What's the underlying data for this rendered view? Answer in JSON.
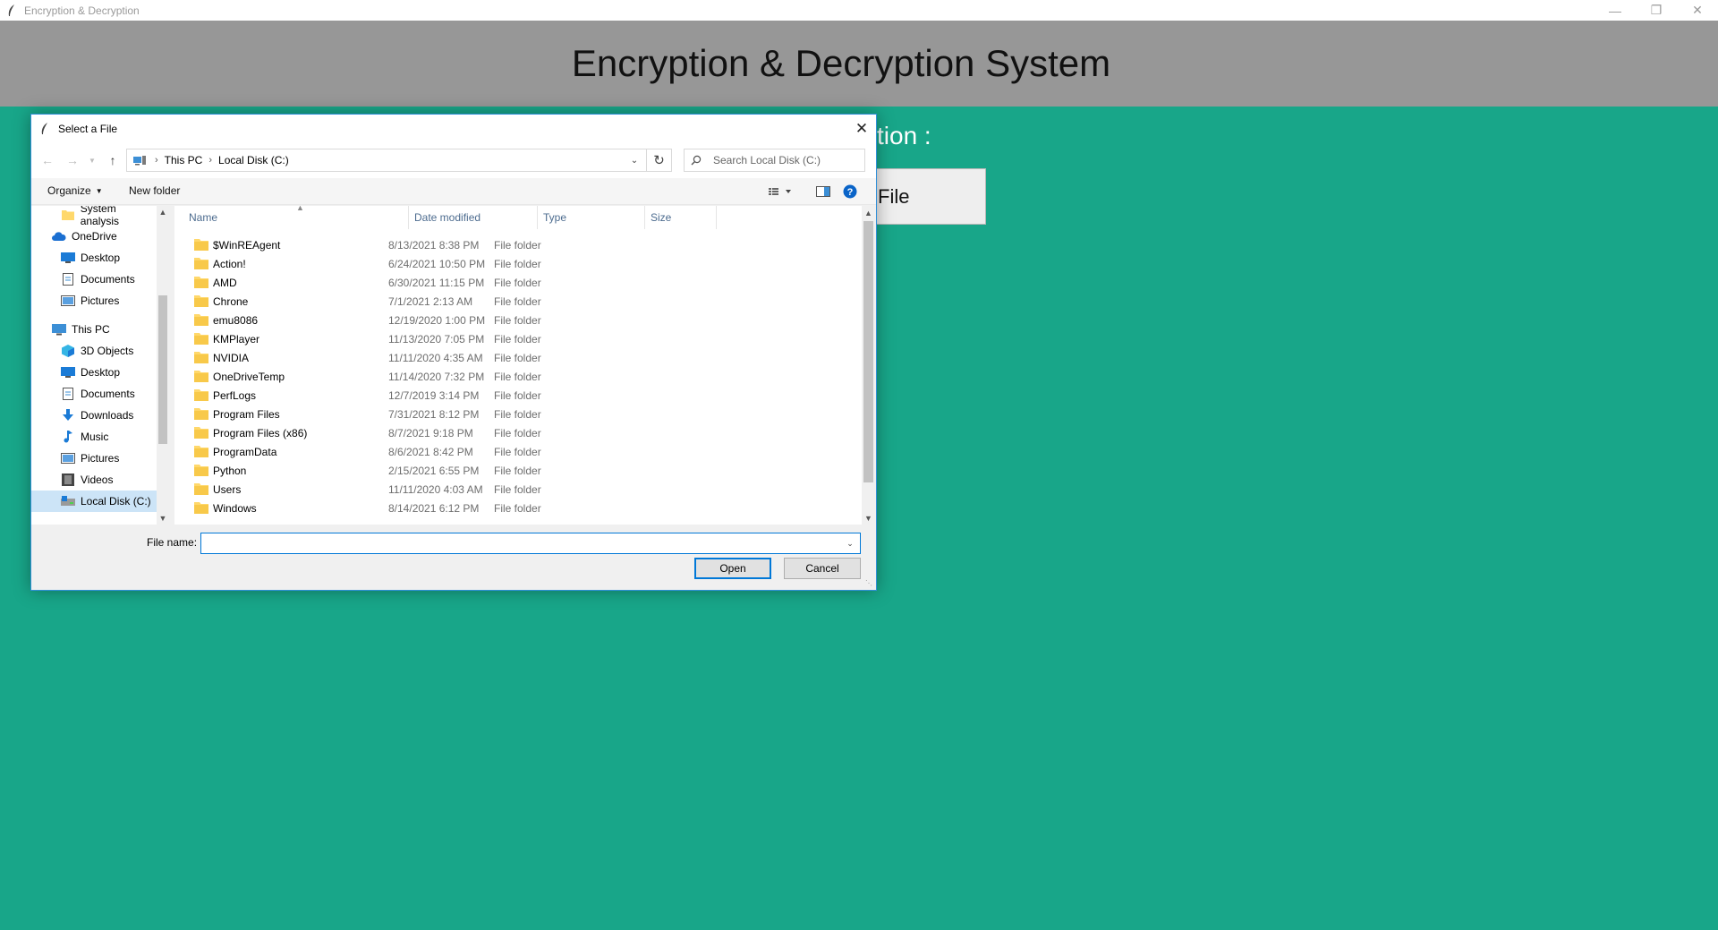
{
  "window": {
    "title": "Encryption & Decryption",
    "controls": [
      "minimize",
      "restore",
      "close"
    ]
  },
  "app": {
    "heading": "Encryption & Decryption System",
    "section_label_partial": "tion :",
    "file_button_partial": "File"
  },
  "dialog": {
    "title": "Select a File",
    "breadcrumb": [
      "This PC",
      "Local Disk (C:)"
    ],
    "search_placeholder": "Search Local Disk (C:)",
    "toolbar": {
      "organize": "Organize",
      "new_folder": "New folder"
    },
    "nav_pane": [
      {
        "label": "System analysis",
        "icon": "folder-icon"
      },
      {
        "label": "OneDrive",
        "icon": "cloud-icon"
      },
      {
        "label": "Desktop",
        "icon": "desktop-icon"
      },
      {
        "label": "Documents",
        "icon": "documents-icon"
      },
      {
        "label": "Pictures",
        "icon": "pictures-icon"
      },
      {
        "label": "This PC",
        "icon": "computer-icon"
      },
      {
        "label": "3D Objects",
        "icon": "cube-icon"
      },
      {
        "label": "Desktop",
        "icon": "desktop-icon"
      },
      {
        "label": "Documents",
        "icon": "documents-icon"
      },
      {
        "label": "Downloads",
        "icon": "download-icon"
      },
      {
        "label": "Music",
        "icon": "music-icon"
      },
      {
        "label": "Pictures",
        "icon": "pictures-icon"
      },
      {
        "label": "Videos",
        "icon": "video-icon"
      },
      {
        "label": "Local Disk (C:)",
        "icon": "drive-icon"
      }
    ],
    "columns": [
      "Name",
      "Date modified",
      "Type",
      "Size"
    ],
    "files": [
      {
        "name": "$WinREAgent",
        "date": "8/13/2021 8:38 PM",
        "type": "File folder"
      },
      {
        "name": "Action!",
        "date": "6/24/2021 10:50 PM",
        "type": "File folder"
      },
      {
        "name": "AMD",
        "date": "6/30/2021 11:15 PM",
        "type": "File folder"
      },
      {
        "name": "Chrone",
        "date": "7/1/2021 2:13 AM",
        "type": "File folder"
      },
      {
        "name": "emu8086",
        "date": "12/19/2020 1:00 PM",
        "type": "File folder"
      },
      {
        "name": "KMPlayer",
        "date": "11/13/2020 7:05 PM",
        "type": "File folder"
      },
      {
        "name": "NVIDIA",
        "date": "11/11/2020 4:35 AM",
        "type": "File folder"
      },
      {
        "name": "OneDriveTemp",
        "date": "11/14/2020 7:32 PM",
        "type": "File folder"
      },
      {
        "name": "PerfLogs",
        "date": "12/7/2019 3:14 PM",
        "type": "File folder"
      },
      {
        "name": "Program Files",
        "date": "7/31/2021 8:12 PM",
        "type": "File folder"
      },
      {
        "name": "Program Files (x86)",
        "date": "8/7/2021 9:18 PM",
        "type": "File folder"
      },
      {
        "name": "ProgramData",
        "date": "8/6/2021 8:42 PM",
        "type": "File folder"
      },
      {
        "name": "Python",
        "date": "2/15/2021 6:55 PM",
        "type": "File folder"
      },
      {
        "name": "Users",
        "date": "11/11/2020 4:03 AM",
        "type": "File folder"
      },
      {
        "name": "Windows",
        "date": "8/14/2021 6:12 PM",
        "type": "File folder"
      }
    ],
    "file_name_label": "File name:",
    "file_name_value": "",
    "buttons": {
      "open": "Open",
      "cancel": "Cancel"
    }
  },
  "colors": {
    "background": "#18a689",
    "header": "#979797",
    "accent": "#0078d7",
    "folder": "#ffd86b"
  }
}
